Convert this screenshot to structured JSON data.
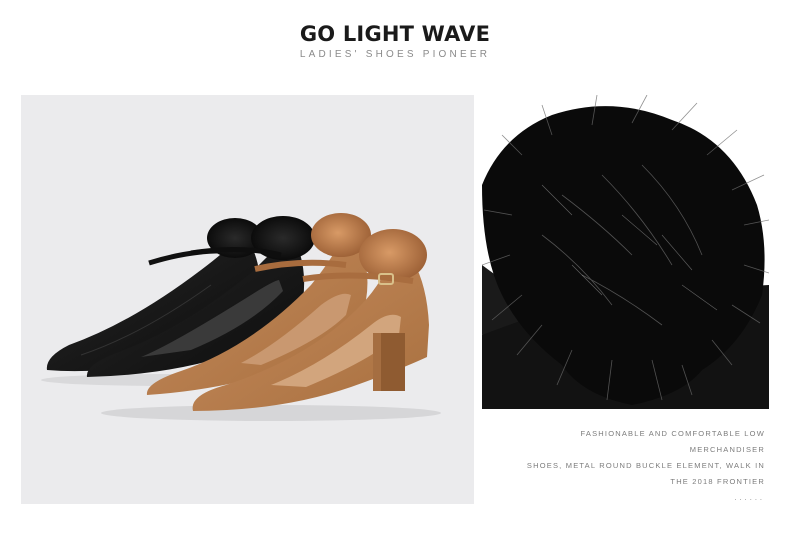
{
  "header": {
    "title": "GO LIGHT WAVE",
    "subtitle": "LADIES' SHOES PIONEER"
  },
  "description": {
    "lines": [
      "FASHIONABLE AND COMFORTABLE LOW",
      "MERCHANDISER",
      "SHOES, METAL ROUND BUCKLE ELEMENT, WALK IN",
      "THE 2018 FRONTIER"
    ],
    "dots": "......"
  },
  "colors": {
    "panel_bg": "#ebebed",
    "black_suede": "#141414",
    "camel_suede": "#b47a4e",
    "fur_black": "#0b0b0b"
  }
}
